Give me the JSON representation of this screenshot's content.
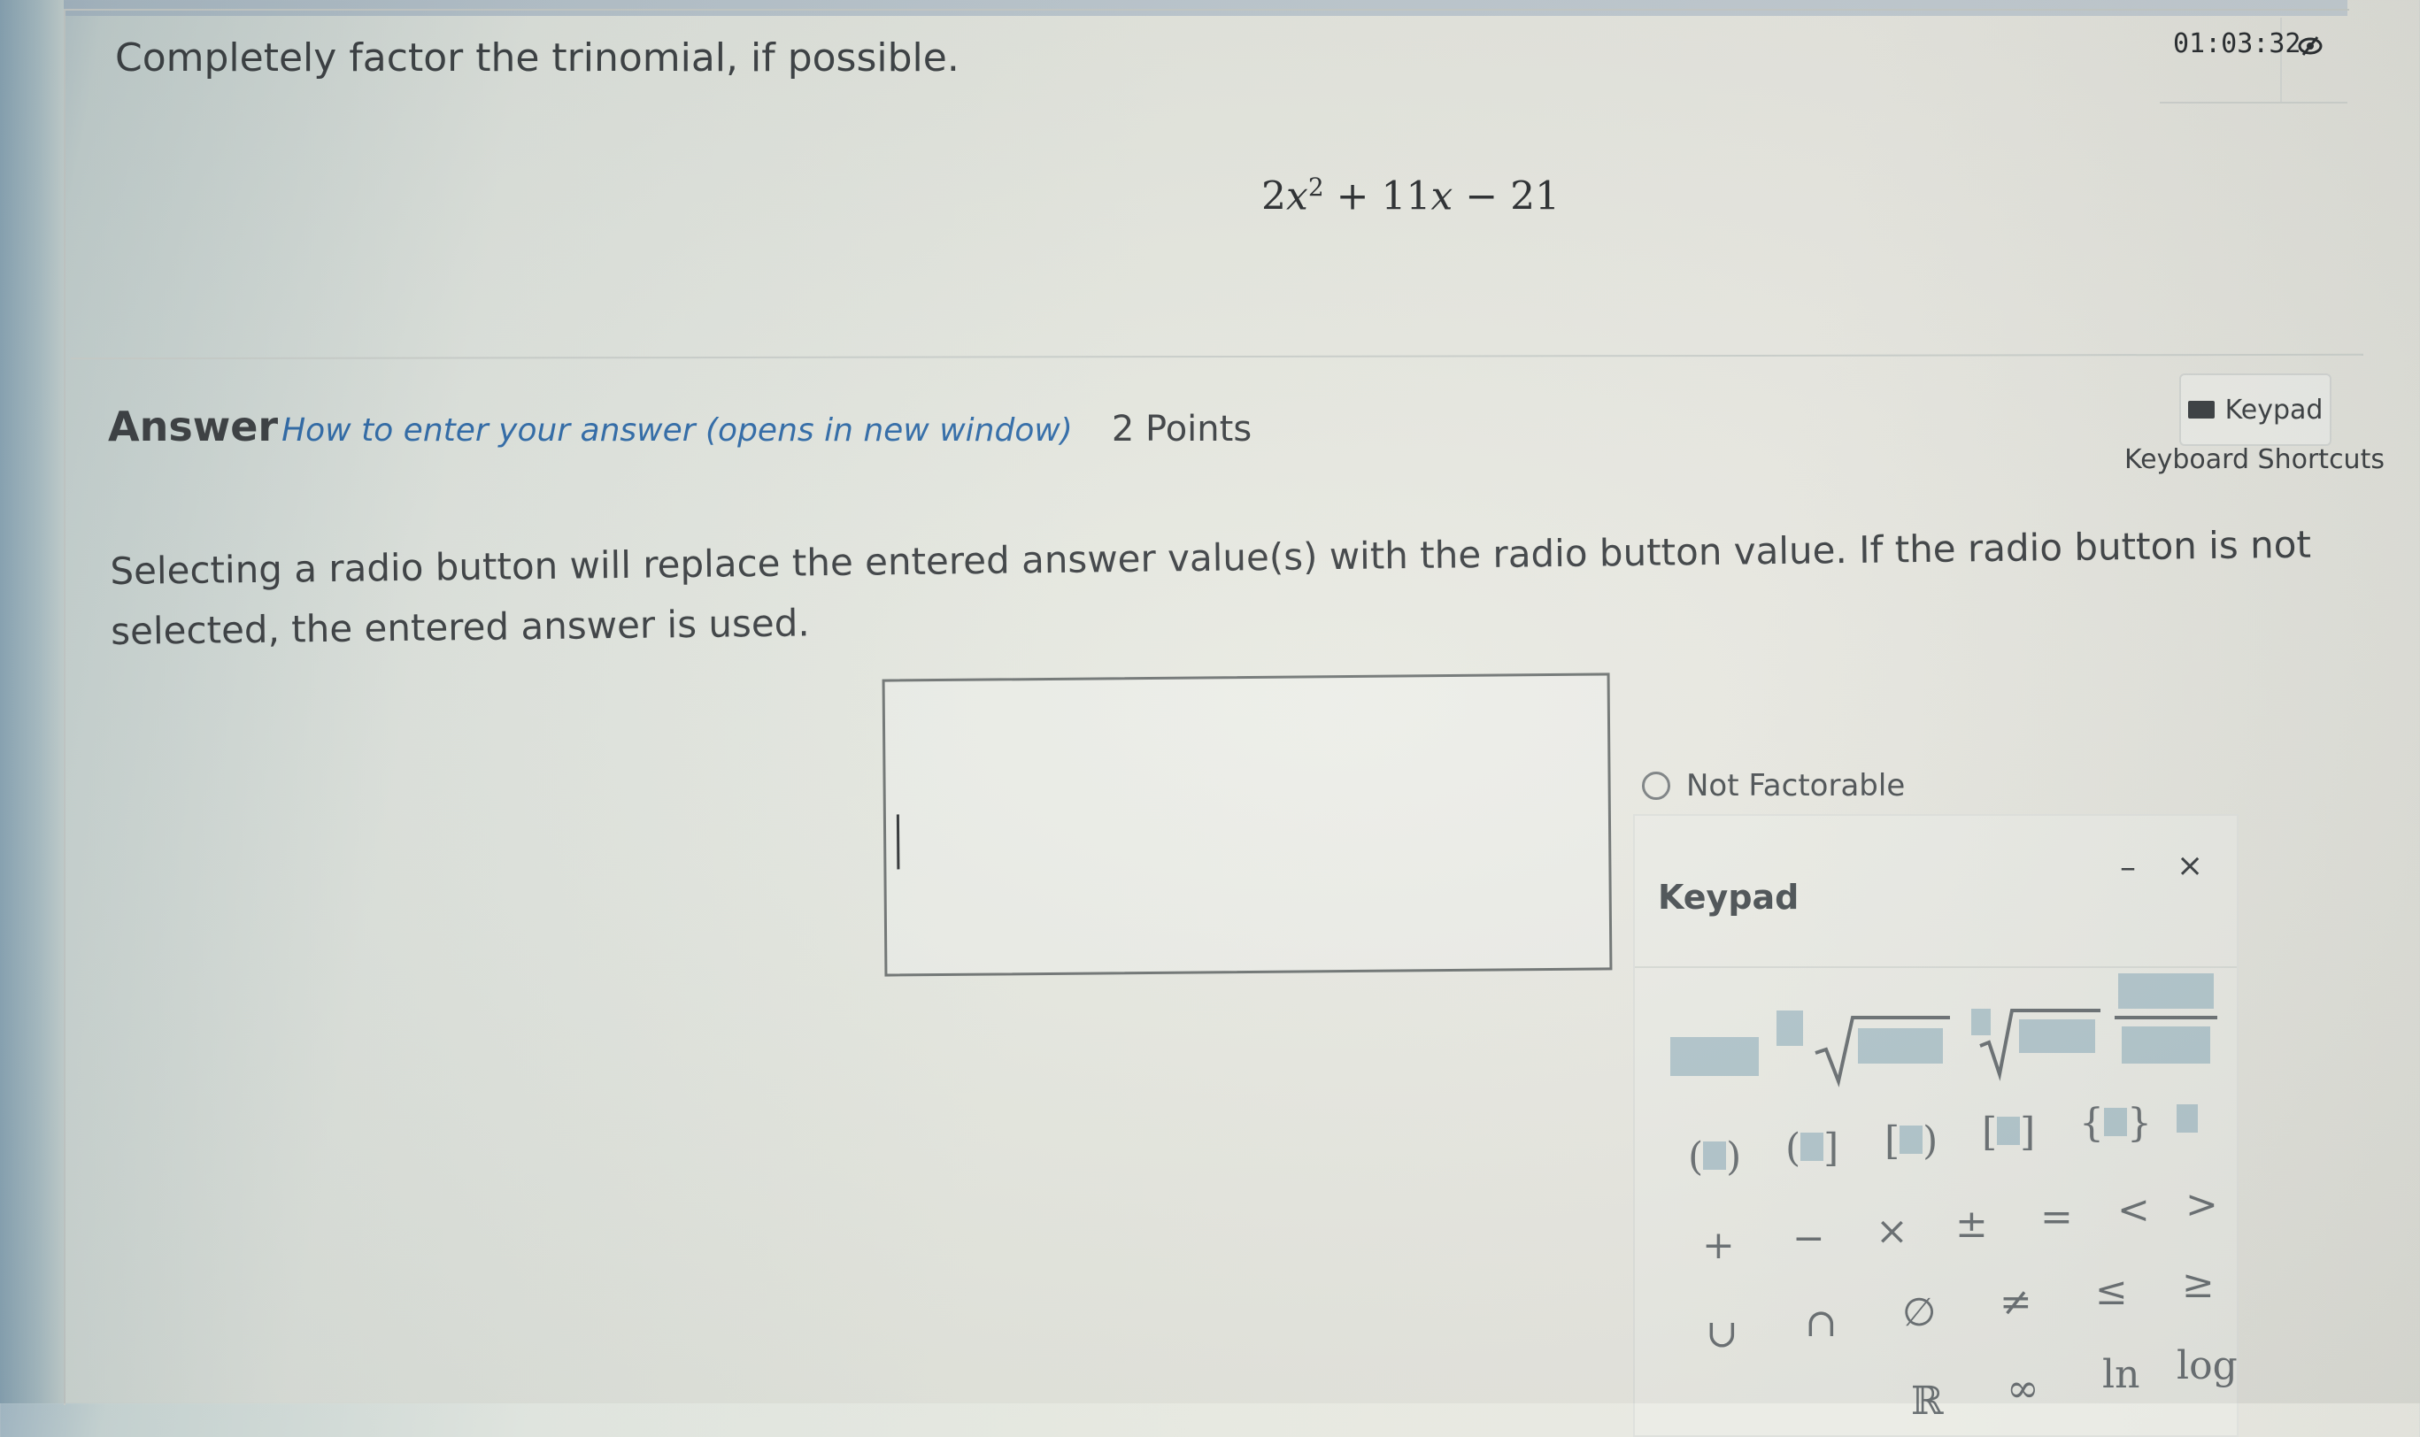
{
  "question": {
    "prompt": "Completely factor the trinomial, if possible.",
    "expression_coef": "2",
    "expression_var": "x",
    "expression_exp": "2",
    "expression_rest_a": "+ 11",
    "expression_rest_var": "x",
    "expression_rest_b": "− 21"
  },
  "timer": {
    "value": "01:03:32"
  },
  "answer": {
    "label": "Answer",
    "help_link": "How to enter your answer (opens in new window)",
    "points": "2 Points",
    "keypad_button": "Keypad",
    "keyboard_shortcuts": "Keyboard Shortcuts",
    "instructions": "Selecting a radio button will replace the entered answer value(s) with the radio button value. If the radio button is not selected, the entered answer is used.",
    "input_value": "",
    "radio_label": "Not Factorable"
  },
  "keypad": {
    "title": "Keypad",
    "minimize": "–",
    "close": "×",
    "brackets": [
      "(",
      ")",
      "(",
      "]",
      "[",
      ")",
      "[",
      "]",
      "{",
      "}"
    ],
    "row_ops": [
      "+",
      "−",
      "×",
      "±",
      "=",
      "<",
      ">"
    ],
    "row_sets": [
      "∪",
      "∩",
      "∅",
      "≠",
      "≤",
      "≥"
    ],
    "row_funcs": [
      "ℝ",
      "∞",
      "ln",
      "log"
    ]
  },
  "colors": {
    "link": "#2e6aa8",
    "placeholder": "#b2c6cc",
    "text": "#3b3f42"
  }
}
